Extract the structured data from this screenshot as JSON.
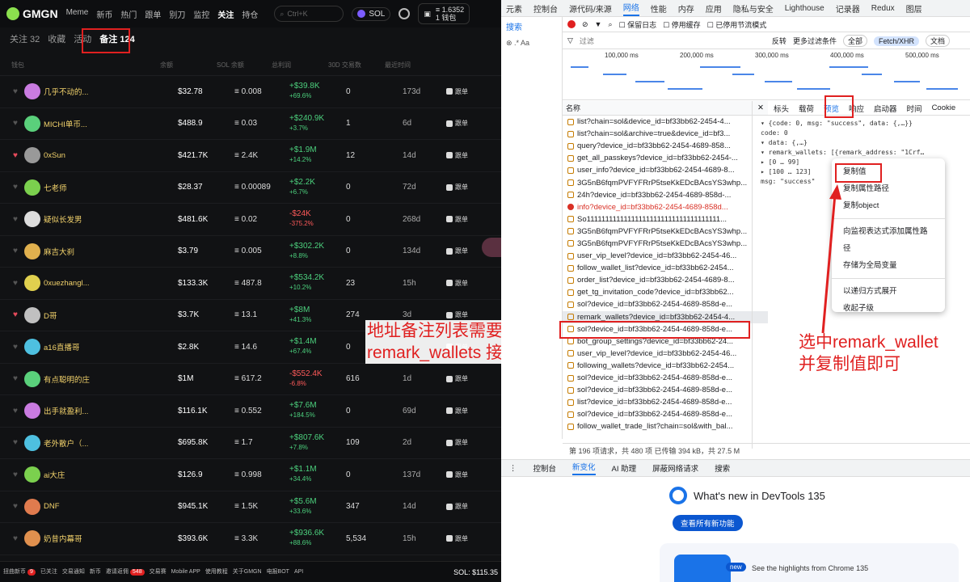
{
  "gmgn": {
    "logo": "GMGN",
    "nav": [
      "Meme",
      "新币",
      "热门",
      "跟单",
      "别刀",
      "监控",
      "关注",
      "持仓"
    ],
    "nav_active": "关注",
    "search_placeholder": "Ctrl+K",
    "chain": "SOL",
    "wallet_balance": "≡ 1.6352",
    "wallet_count": "1 钱包",
    "subtabs": [
      "关注 32",
      "收藏",
      "活动",
      "备注 124"
    ],
    "headers": [
      "钱包",
      "余额",
      "SOL 余额",
      "总利润",
      "30D 交易数",
      "最近时间"
    ],
    "action_label": "跟单",
    "rows": [
      {
        "name": "几乎不动的...",
        "bal": "$32.78",
        "sol": "≡ 0.008",
        "pnl": "+$39.8K",
        "pct": "+69.6%",
        "up": true,
        "tx": "0",
        "time": "173d",
        "fav": false,
        "color": "#c97be0"
      },
      {
        "name": "MICHI单币...",
        "bal": "$488.9",
        "sol": "≡ 0.03",
        "pnl": "+$240.9K",
        "pct": "+3.7%",
        "up": true,
        "tx": "1",
        "time": "6d",
        "fav": false,
        "color": "#5ad07b"
      },
      {
        "name": "0xSun",
        "bal": "$421.7K",
        "sol": "≡ 2.4K",
        "pnl": "+$1.9M",
        "pct": "+14.2%",
        "up": true,
        "tx": "12",
        "time": "14d",
        "fav": true,
        "color": "#999999"
      },
      {
        "name": "七老师",
        "bal": "$28.37",
        "sol": "≡ 0.00089",
        "pnl": "+$2.2K",
        "pct": "+6.7%",
        "up": true,
        "tx": "0",
        "time": "72d",
        "fav": false,
        "color": "#7bd04e"
      },
      {
        "name": "疑似长发男",
        "bal": "$481.6K",
        "sol": "≡ 0.02",
        "pnl": "-$24K",
        "pct": "-375.2%",
        "up": false,
        "tx": "0",
        "time": "268d",
        "fav": false,
        "color": "#dddddd"
      },
      {
        "name": "麻吉大刹",
        "bal": "$3.79",
        "sol": "≡ 0.005",
        "pnl": "+$302.2K",
        "pct": "+8.8%",
        "up": true,
        "tx": "0",
        "time": "134d",
        "fav": false,
        "color": "#e0b04e"
      },
      {
        "name": "0xuezhangl...",
        "bal": "$133.3K",
        "sol": "≡ 487.8",
        "pnl": "+$534.2K",
        "pct": "+10.2%",
        "up": true,
        "tx": "23",
        "time": "15h",
        "fav": false,
        "color": "#e0d04e"
      },
      {
        "name": "D哥",
        "bal": "$3.7K",
        "sol": "≡ 13.1",
        "pnl": "+$8M",
        "pct": "+41.3%",
        "up": true,
        "tx": "274",
        "time": "3d",
        "fav": true,
        "color": "#c0c0c0"
      },
      {
        "name": "a16直播哥",
        "bal": "$2.8K",
        "sol": "≡ 14.6",
        "pnl": "+$1.4M",
        "pct": "+67.4%",
        "up": true,
        "tx": "0",
        "time": "",
        "fav": false,
        "color": "#4ec0e0"
      },
      {
        "name": "有点聪明的庄",
        "bal": "$1M",
        "sol": "≡ 617.2",
        "pnl": "-$552.4K",
        "pct": "-6.8%",
        "up": false,
        "tx": "616",
        "time": "1d",
        "fav": false,
        "color": "#5ad07b"
      },
      {
        "name": "出手就盈利...",
        "bal": "$116.1K",
        "sol": "≡ 0.552",
        "pnl": "+$7.6M",
        "pct": "+184.5%",
        "up": true,
        "tx": "0",
        "time": "69d",
        "fav": false,
        "color": "#c97be0"
      },
      {
        "name": "老外散户（...",
        "bal": "$695.8K",
        "sol": "≡ 1.7",
        "pnl": "+$807.6K",
        "pct": "+7.8%",
        "up": true,
        "tx": "109",
        "time": "2d",
        "fav": false,
        "color": "#4ec0e0"
      },
      {
        "name": "ai大庄",
        "bal": "$126.9",
        "sol": "≡ 0.998",
        "pnl": "+$1.1M",
        "pct": "+34.4%",
        "up": true,
        "tx": "0",
        "time": "137d",
        "fav": false,
        "color": "#7bd04e"
      },
      {
        "name": "DNF",
        "bal": "$945.1K",
        "sol": "≡ 1.5K",
        "pnl": "+$5.6M",
        "pct": "+33.6%",
        "up": true,
        "tx": "347",
        "time": "14d",
        "fav": false,
        "color": "#e07b4e"
      },
      {
        "name": "奶昔内幕哥",
        "bal": "$393.6K",
        "sol": "≡ 3.3K",
        "pnl": "+$936.6K",
        "pct": "+88.6%",
        "up": true,
        "tx": "5,534",
        "time": "15h",
        "fav": false,
        "color": "#e0904e"
      }
    ],
    "bottom": [
      {
        "label": "扭曲新币",
        "badge": "9"
      },
      {
        "label": "已关注"
      },
      {
        "label": "交易通知"
      },
      {
        "label": "新币"
      },
      {
        "label": "邀请返佣",
        "badge": "548"
      },
      {
        "label": "交易赛"
      },
      {
        "label": "Mobile APP"
      },
      {
        "label": "使用教程"
      },
      {
        "label": "关于GMGN"
      },
      {
        "label": "电报BOT"
      },
      {
        "label": "API"
      }
    ],
    "sol_price": "SOL: $115.35",
    "annotation": "地址备注列表需要找到\nremark_wallets 接口"
  },
  "devtools": {
    "tabs": [
      "元素",
      "控制台",
      "源代码/来源",
      "网络",
      "性能",
      "内存",
      "应用",
      "隐私与安全",
      "Lighthouse",
      "记录器",
      "Redux",
      "图层"
    ],
    "active_tab": "网络",
    "left_tab": "搜索",
    "toolbar": [
      "保留日志",
      "停用缓存",
      "已停用节流模式"
    ],
    "filter_placeholder": "过滤",
    "filter_opts": [
      "反转",
      "更多过滤条件",
      "全部",
      "Fetch/XHR",
      "文档"
    ],
    "timeline_labels": [
      "100,000 ms",
      "200,000 ms",
      "300,000 ms",
      "400,000 ms",
      "500,000 ms"
    ],
    "col_name": "名称",
    "requests": [
      {
        "t": "list?chain=sol&device_id=bf33bb62-2454-4..."
      },
      {
        "t": "list?chain=sol&archive=true&device_id=bf3..."
      },
      {
        "t": "query?device_id=bf33bb62-2454-4689-858..."
      },
      {
        "t": "get_all_passkeys?device_id=bf33bb62-2454-..."
      },
      {
        "t": "user_info?device_id=bf33bb62-2454-4689-8..."
      },
      {
        "t": "3G5nB6fqmPVFYFRrP5tseKkEDcBAcsYS3whp..."
      },
      {
        "t": "24h?device_id=bf33bb62-2454-4689-858d-..."
      },
      {
        "t": "info?device_id=bf33bb62-2454-4689-858d...",
        "err": true
      },
      {
        "t": "So111111111111111111111111111111111111..."
      },
      {
        "t": "3G5nB6fqmPVFYFRrP5tseKkEDcBAcsYS3whp..."
      },
      {
        "t": "3G5nB6fqmPVFYFRrP5tseKkEDcBAcsYS3whp..."
      },
      {
        "t": "user_vip_level?device_id=bf33bb62-2454-46..."
      },
      {
        "t": "follow_wallet_list?device_id=bf33bb62-2454..."
      },
      {
        "t": "order_list?device_id=bf33bb62-2454-4689-8..."
      },
      {
        "t": "get_tg_invitation_code?device_id=bf33bb62..."
      },
      {
        "t": "sol?device_id=bf33bb62-2454-4689-858d-e..."
      },
      {
        "t": "remark_wallets?device_id=bf33bb62-2454-4...",
        "sel": true
      },
      {
        "t": "sol?device_id=bf33bb62-2454-4689-858d-e..."
      },
      {
        "t": "bot_group_settings?device_id=bf33bb62-24..."
      },
      {
        "t": "user_vip_level?device_id=bf33bb62-2454-46..."
      },
      {
        "t": "following_wallets?device_id=bf33bb62-2454..."
      },
      {
        "t": "sol?device_id=bf33bb62-2454-4689-858d-e..."
      },
      {
        "t": "sol?device_id=bf33bb62-2454-4689-858d-e..."
      },
      {
        "t": "list?device_id=bf33bb62-2454-4689-858d-e..."
      },
      {
        "t": "sol?device_id=bf33bb62-2454-4689-858d-e..."
      },
      {
        "t": "follow_wallet_trade_list?chain=sol&with_bal..."
      }
    ],
    "preview_tabs": [
      "标头",
      "载荷",
      "预览",
      "响应",
      "启动器",
      "时间",
      "Cookie"
    ],
    "preview_active": "预览",
    "preview_lines": [
      "▾ {code: 0, msg: \"success\", data: {,…}}",
      "    code: 0",
      "  ▾ data: {,…}",
      "    ▾ remark_wallets: [{remark_address: \"1Crf…",
      "      ▸ [0 … 99]",
      "      ▸ [100 … 123]",
      "    msg: \"success\""
    ],
    "context_menu": [
      "复制值",
      "复制属性路径",
      "复制object",
      "-",
      "向监视表达式添加属性路径",
      "存储为全局变量",
      "-",
      "以递归方式展开",
      "收起子级"
    ],
    "status": "第 196 项请求，共 480 项   已传输 394 kB，共 27.5 M",
    "drawer_tabs": [
      "控制台",
      "新变化",
      "AI 助理",
      "屏蔽网络请求",
      "搜索"
    ],
    "drawer_active": "新变化",
    "whats_new": "What's new in DevTools 135",
    "all_btn": "查看所有新功能",
    "new_badge": "new",
    "card_text": "See the highlights from Chrome 135",
    "annotation": "选中remark_wallet\n并复制值即可"
  }
}
